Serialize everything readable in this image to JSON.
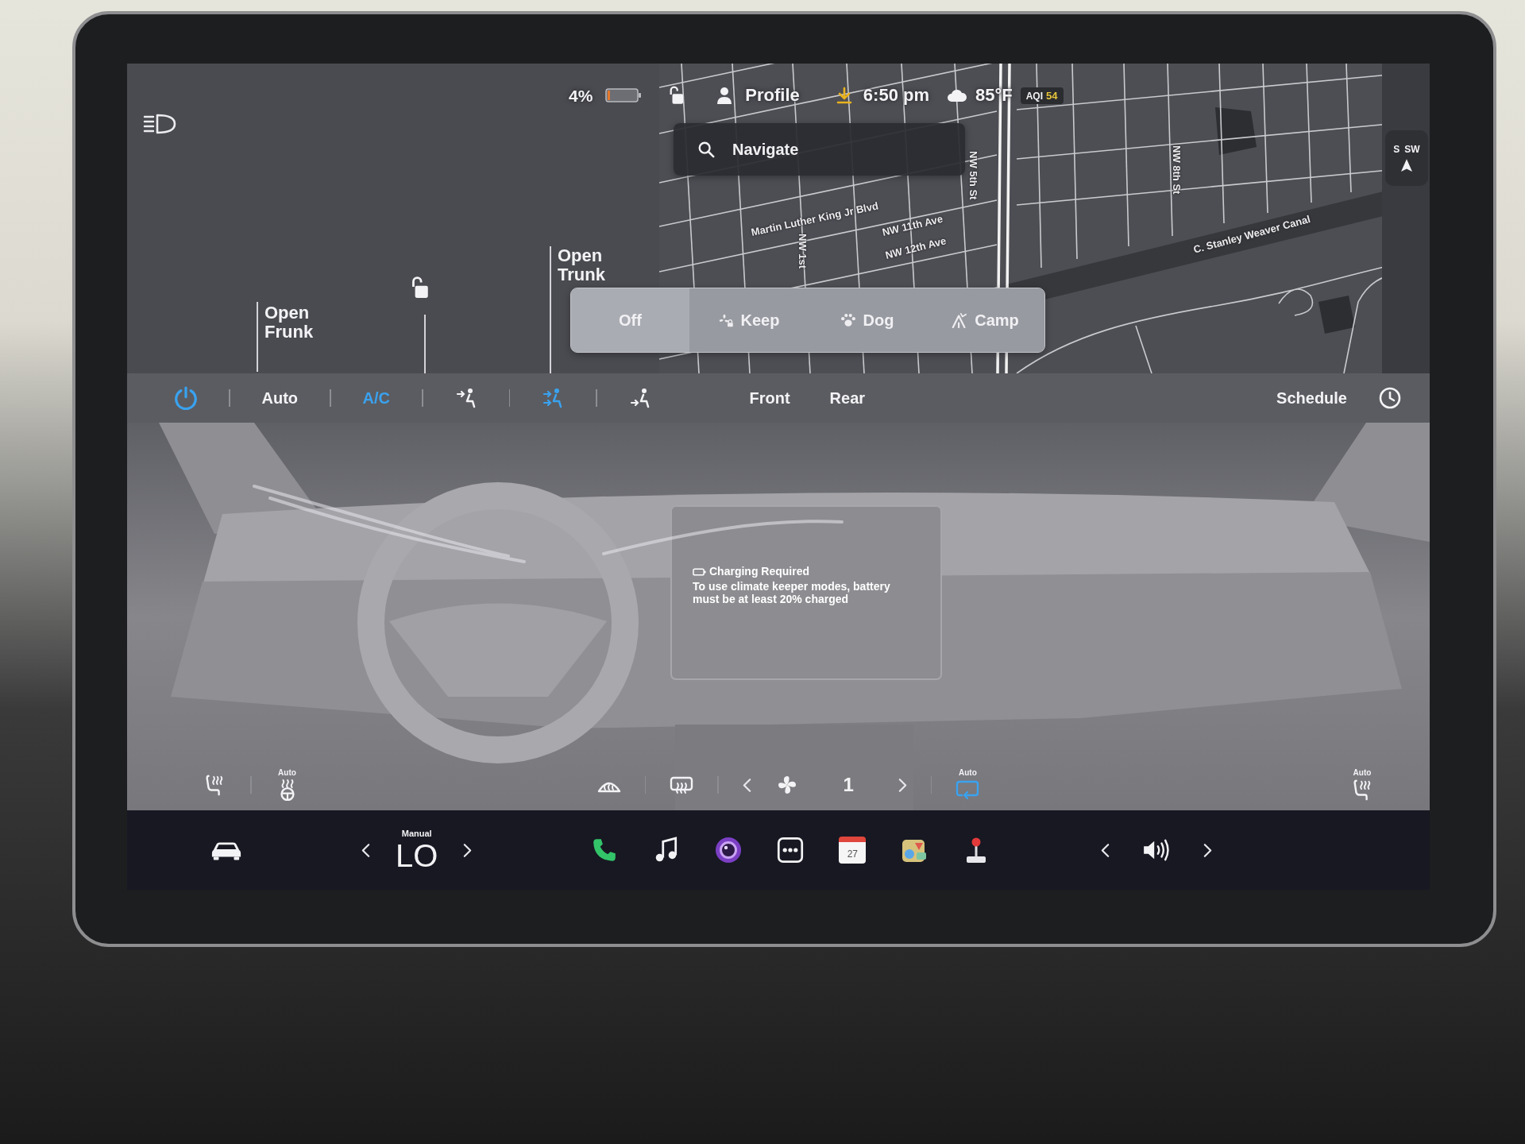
{
  "status_bar": {
    "battery": "4%",
    "profile": "Profile",
    "time": "6:50 pm",
    "temperature": "85°F",
    "aqi_label": "AQI",
    "aqi_value": "54"
  },
  "navigation": {
    "search": {
      "placeholder": "Navigate"
    },
    "compass": [
      "S",
      "SW"
    ],
    "map_labels": [
      "Martin Luther King Jr Blvd",
      "NW 11th Ave",
      "NW 12th Ave",
      "NW 5th St",
      "NW 1st",
      "NW 8th St",
      "C. Stanley Weaver Canal"
    ]
  },
  "car_panel": {
    "frunk": "Open Frunk",
    "trunk": "Open Trunk",
    "locked": false
  },
  "climate_keeper": {
    "options": [
      {
        "label": "Off",
        "kind": "off",
        "selected": true
      },
      {
        "label": "Keep",
        "kind": "keep",
        "selected": false
      },
      {
        "label": "Dog",
        "kind": "dog",
        "selected": false
      },
      {
        "label": "Camp",
        "kind": "camp",
        "selected": false
      }
    ]
  },
  "climate_bar": {
    "power_on": true,
    "auto": {
      "label": "Auto",
      "on": false
    },
    "ac": {
      "label": "A/C",
      "on": true
    },
    "airflow_modes": [
      {
        "kind": "face",
        "selected": false
      },
      {
        "kind": "face_feet",
        "selected": true
      },
      {
        "kind": "feet",
        "selected": false
      }
    ],
    "zones": [
      "Front",
      "Rear"
    ],
    "schedule": "Schedule"
  },
  "alert": {
    "title": "Charging Required",
    "message": "To use climate keeper modes, battery must be at least 20% charged"
  },
  "cabin_controls": {
    "left": [
      {
        "kind": "seat_heater",
        "on": false
      },
      {
        "kind": "steering_heater",
        "caption": "Auto",
        "on": false
      }
    ],
    "defrost": [
      {
        "kind": "front_defrost",
        "on": false
      },
      {
        "kind": "rear_defrost",
        "on": false
      }
    ],
    "fan_speed": "1",
    "recirculation": {
      "caption": "Auto",
      "on": true
    },
    "right": [
      {
        "kind": "seat_heater",
        "caption": "Auto",
        "on": false
      }
    ]
  },
  "taskbar": {
    "temperature": {
      "mode": "Manual",
      "value": "LO"
    },
    "apps": [
      {
        "kind": "phone"
      },
      {
        "kind": "music"
      },
      {
        "kind": "camera"
      },
      {
        "kind": "more"
      },
      {
        "kind": "calendar",
        "day": "27"
      },
      {
        "kind": "toybox"
      },
      {
        "kind": "arcade"
      }
    ],
    "volume": {
      "muted": false
    }
  }
}
